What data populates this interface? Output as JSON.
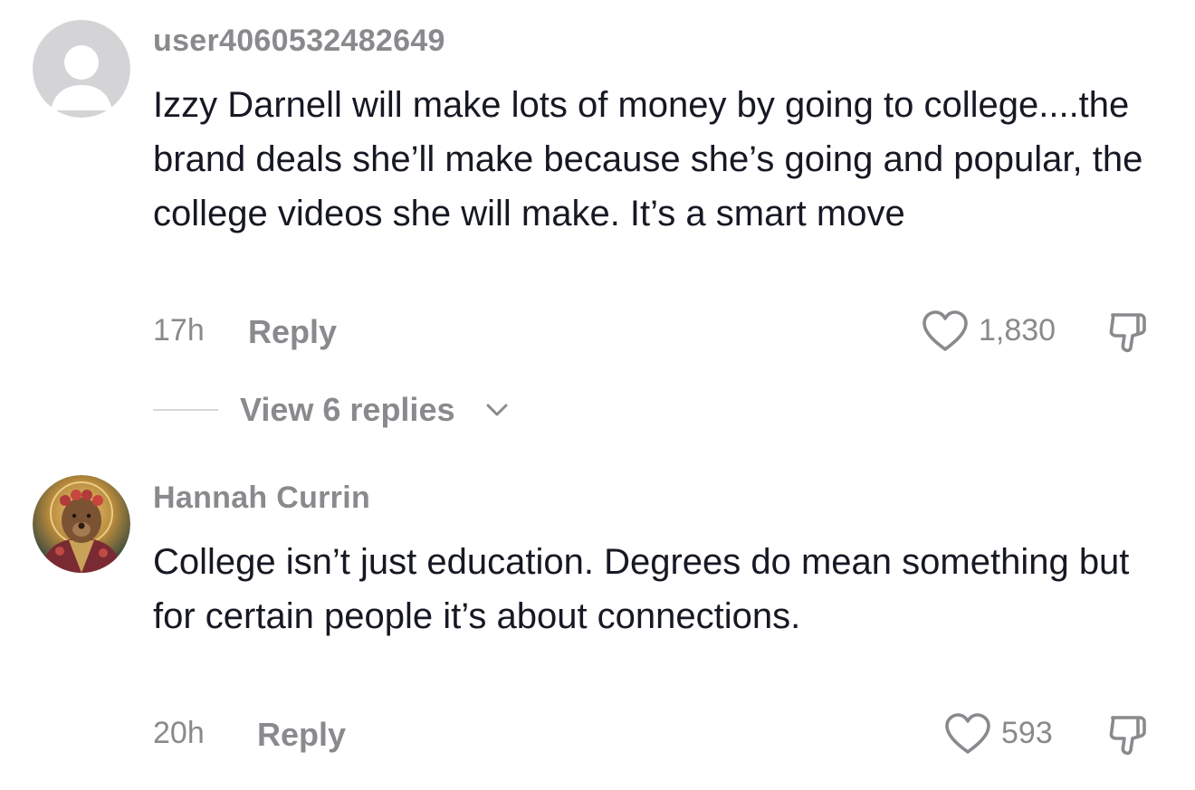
{
  "comments": [
    {
      "username": "user4060532482649",
      "text": "Izzy Darnell will make lots of money by going to college....the brand deals she’ll make because she’s going and popular, the college videos she will make. It’s a smart move",
      "time": "17h",
      "reply_label": "Reply",
      "likes": "1,830",
      "avatar_icon": "default-user-avatar-icon",
      "view_replies_label": "View 6 replies"
    },
    {
      "username": "Hannah Currin",
      "text": "College isn’t just education. Degrees do mean something but for certain people it’s about connections.",
      "time": "20h",
      "reply_label": "Reply",
      "likes": "593",
      "avatar_icon": "bear-portrait-avatar"
    }
  ],
  "colors": {
    "text": "#161823",
    "muted": "#8a8a8e",
    "divider": "#d8d8d8"
  }
}
